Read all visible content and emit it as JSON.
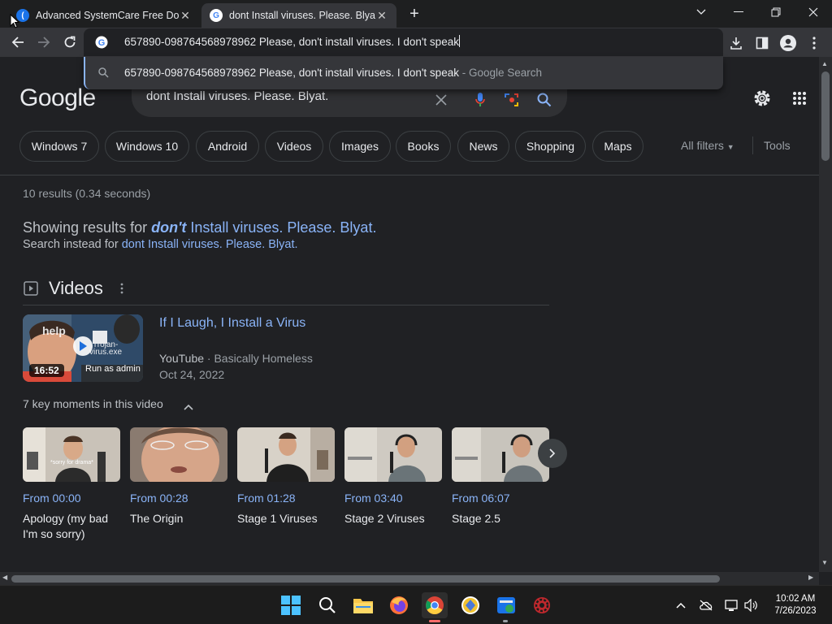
{
  "browser": {
    "tabs": [
      {
        "title": "Advanced SystemCare Free Down",
        "active": false
      },
      {
        "title": "dont Install viruses. Please. Blyat.",
        "active": true
      }
    ],
    "omnibox_text": "657890-098764568978962 Please, don't install viruses. I don't speak",
    "suggestion": {
      "text": "657890-098764568978962 Please, don't install viruses. I don't speak",
      "suffix": " - Google Search"
    }
  },
  "google": {
    "logo": "Google",
    "query": "dont Install viruses. Please. Blyat.",
    "chips": [
      "Windows 7",
      "Windows 10",
      "Android",
      "Videos",
      "Images",
      "Books",
      "News",
      "Shopping",
      "Maps"
    ],
    "all_filters": "All filters",
    "tools": "Tools",
    "stats": "10 results (0.34 seconds)",
    "showing_prefix": "Showing results for ",
    "showing_bold": "don't",
    "showing_rest": " Install viruses. Please. Blyat.",
    "instead_prefix": "Search instead for ",
    "instead_link": "dont Install viruses. Please. Blyat.",
    "videos_heading": "Videos",
    "video": {
      "title": "If I Laugh, I Install a Virus",
      "source": "YouTube",
      "channel": "Basically Homeless",
      "date": "Oct 24, 2022",
      "duration": "16:52",
      "thumb_text_1": "help",
      "thumb_text_2": "Trojan-",
      "thumb_text_3": "virus.exe",
      "thumb_text_4": "Run as admin"
    },
    "key_moments_label": "7 key moments in this video",
    "moments": [
      {
        "from": "From 00:00",
        "label": "Apology (my bad I'm so sorry)",
        "caption": "*sorry for drama*"
      },
      {
        "from": "From 00:28",
        "label": "The Origin"
      },
      {
        "from": "From 01:28",
        "label": "Stage 1 Viruses"
      },
      {
        "from": "From 03:40",
        "label": "Stage 2 Viruses"
      },
      {
        "from": "From 06:07",
        "label": "Stage 2.5"
      }
    ]
  },
  "taskbar": {
    "time": "10:02 AM",
    "date": "7/26/2023"
  },
  "colors": {
    "page_bg": "#202124",
    "link": "#8ab4f8",
    "chrome_bg": "#35363a"
  }
}
